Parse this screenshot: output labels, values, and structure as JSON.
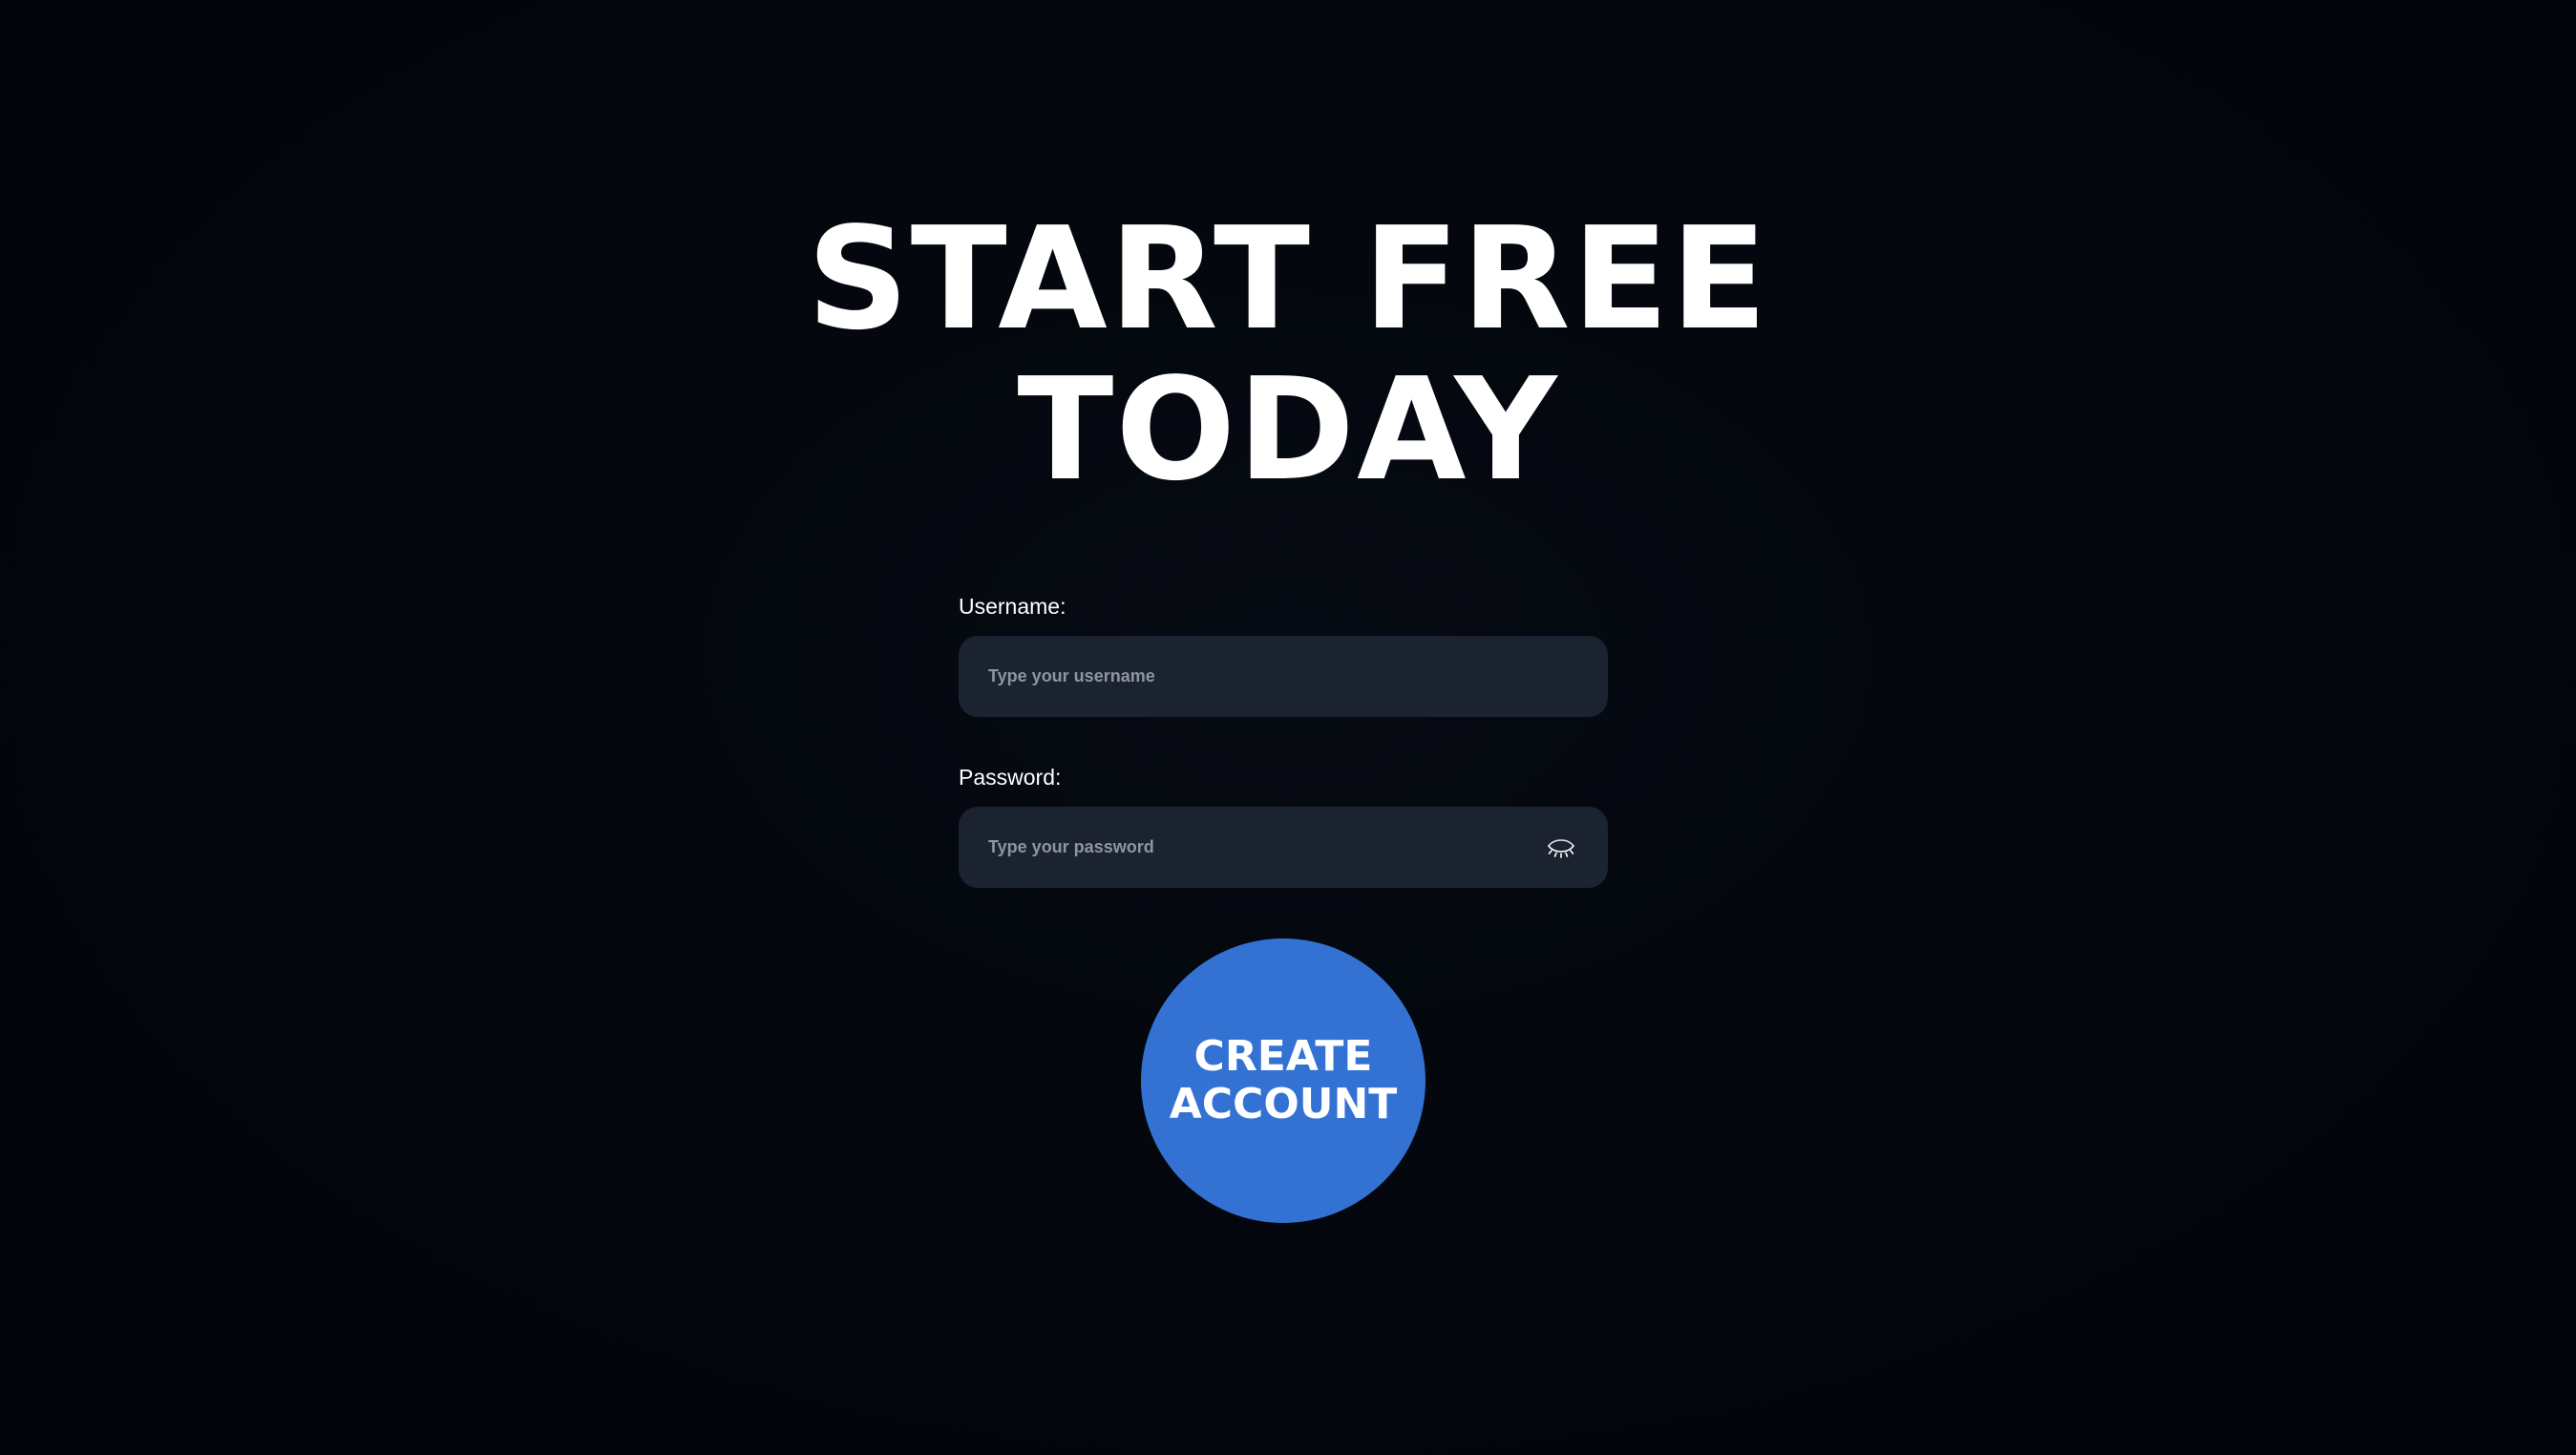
{
  "headline": {
    "line1": "START FREE",
    "line2": "TODAY"
  },
  "form": {
    "username": {
      "label": "Username:",
      "placeholder": "Type your username",
      "value": ""
    },
    "password": {
      "label": "Password:",
      "placeholder": "Type your password",
      "value": "",
      "toggle_icon": "eye-closed-icon"
    },
    "submit": {
      "line1": "CREATE",
      "line2": "ACCOUNT"
    }
  },
  "colors": {
    "background": "#03060c",
    "input_background": "#1c2330",
    "accent": "#3372d3",
    "text": "#ffffff",
    "placeholder": "#8d95a3"
  }
}
